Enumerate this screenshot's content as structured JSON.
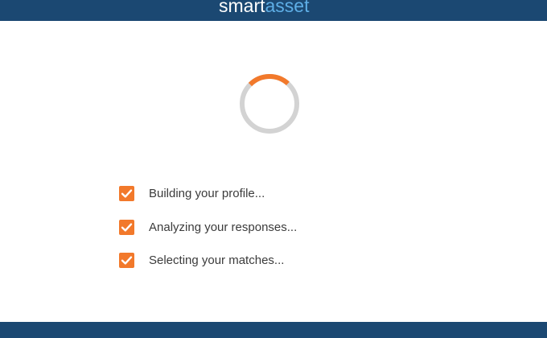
{
  "header": {
    "logo_part1": "smart",
    "logo_part2": "asset",
    "bar_color": "#1b4872",
    "logo_accent_color": "#5eaee6"
  },
  "loader": {
    "icon": "loading-spinner-icon",
    "track_color": "#d3d3d3",
    "active_color": "#f2792b"
  },
  "steps": [
    {
      "label": "Building your profile...",
      "checked": true
    },
    {
      "label": "Analyzing your responses...",
      "checked": true
    },
    {
      "label": "Selecting your matches...",
      "checked": true
    }
  ],
  "checkbox_color": "#f2792b"
}
